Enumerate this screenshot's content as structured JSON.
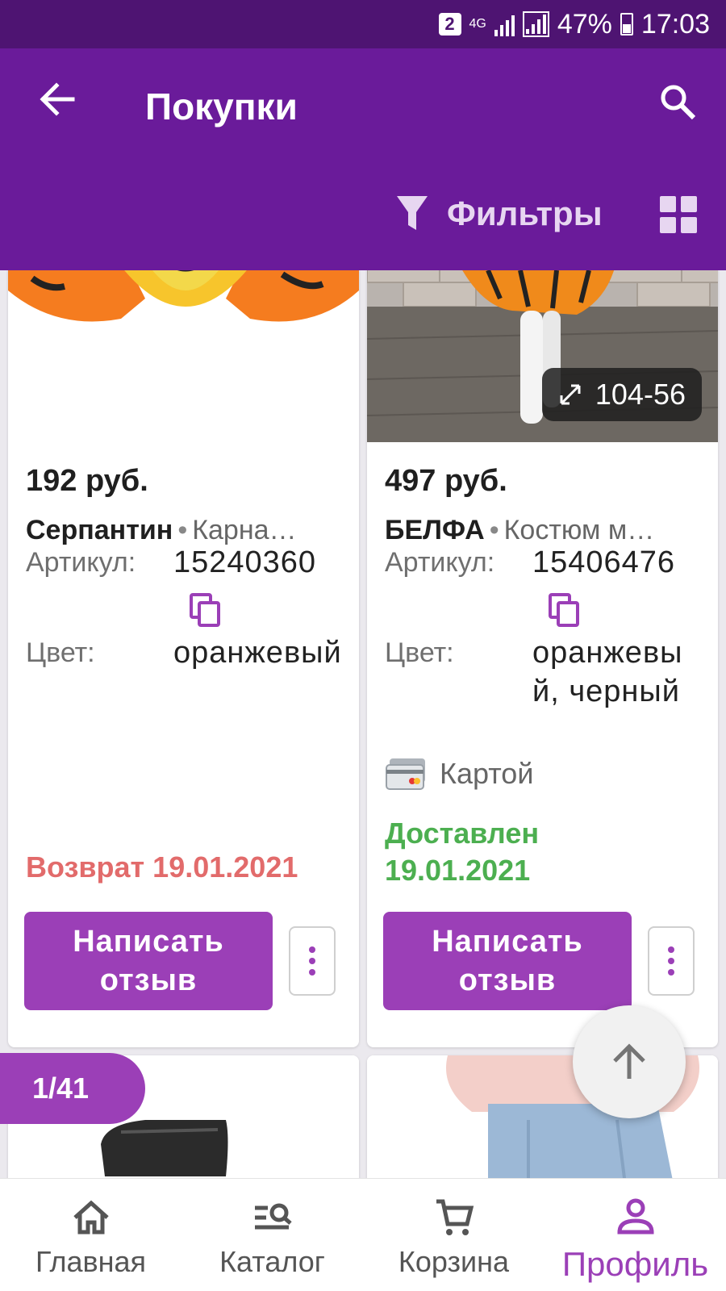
{
  "status_bar": {
    "sim": "2",
    "network": "4G",
    "battery": "47%",
    "time": "17:03"
  },
  "app_bar": {
    "title": "Покупки",
    "filters_label": "Фильтры"
  },
  "products": [
    {
      "price": "192 руб.",
      "brand": "Серпантин",
      "name": "Карна…",
      "sku_label": "Артикул:",
      "sku": "15240360",
      "color_label": "Цвет:",
      "color": "оранжевый",
      "status": "Возврат 19.01.2021",
      "review_label": "Написать отзыв"
    },
    {
      "price": "497 руб.",
      "brand": "БЕЛФА",
      "name": "Костюм м…",
      "sku_label": "Артикул:",
      "sku": "15406476",
      "color_label": "Цвет:",
      "color": "оранжевый, черный",
      "size": "104-56",
      "payment": "Картой",
      "status": "Доставлен 19.01.2021",
      "review_label": "Написать отзыв"
    }
  ],
  "page_counter": "1/41",
  "bottom_nav": {
    "items": [
      {
        "label": "Главная",
        "icon": "home-icon"
      },
      {
        "label": "Каталог",
        "icon": "catalog-search-icon"
      },
      {
        "label": "Корзина",
        "icon": "cart-icon"
      },
      {
        "label": "Профиль",
        "icon": "profile-icon",
        "active": true
      }
    ]
  },
  "colors": {
    "status_bar": "#4e1472",
    "app_bar": "#6a1b9a",
    "accent": "#9b3fb7",
    "return_status": "#e26b6b",
    "delivered_status": "#4caf50"
  }
}
